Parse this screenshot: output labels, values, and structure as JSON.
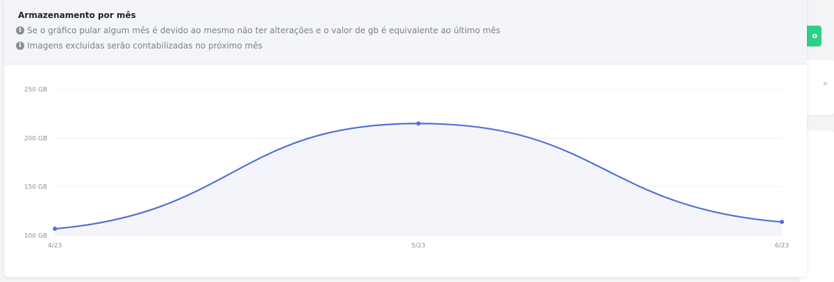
{
  "background": {
    "green_button_label": "o"
  },
  "card": {
    "title": "Armazenamento por mês",
    "info_lines": [
      "Se o gráfico pular algum mês é devido ao mesmo não ter alterações e o valor de gb é equivalente ao último mês",
      "Imagens excluidas serão contabilizadas no próximo mês"
    ]
  },
  "chart_data": {
    "type": "area",
    "categories": [
      "4/23",
      "5/23",
      "6/23"
    ],
    "series": [
      {
        "values": [
          107,
          215,
          114
        ]
      }
    ],
    "y_ticks": [
      "250 GB",
      "200 GB",
      "150 GB",
      "100 GB"
    ],
    "ylim": [
      100,
      250
    ],
    "grid": true,
    "line_color": "#4e6fd8",
    "fill_color": "#f4f5fb"
  }
}
